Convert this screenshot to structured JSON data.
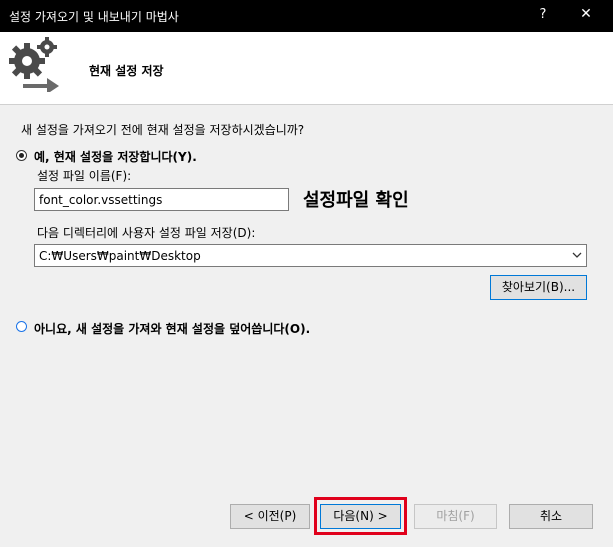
{
  "window": {
    "title": "설정 가져오기 및 내보내기 마법사",
    "help_glyph": "?",
    "close_glyph": "✕"
  },
  "header": {
    "heading": "현재 설정 저장"
  },
  "prompt": "새 설정을 가져오기 전에 현재 설정을 저장하시겠습니까?",
  "option_yes": {
    "label": "예, 현재 설정을 저장합니다(Y).",
    "selected": true
  },
  "file_name": {
    "label": "설정 파일 이름(F):",
    "value": "font_color.vssettings"
  },
  "annotation": "설정파일 확인",
  "directory": {
    "label": "다음 디렉터리에 사용자 설정 파일 저장(D):",
    "value": "C:₩Users₩paint₩Desktop"
  },
  "browse_button": "찾아보기(B)...",
  "option_no": {
    "label": "아니요, 새 설정을 가져와 현재 설정을 덮어씁니다(O).",
    "selected": false
  },
  "footer": {
    "prev_button": "< 이전(P)",
    "next_button": "다음(N) >",
    "finish_button": "마침(F)",
    "cancel_button": "취소"
  },
  "colors": {
    "highlight": "#e0001b",
    "accent": "#0078d7"
  }
}
